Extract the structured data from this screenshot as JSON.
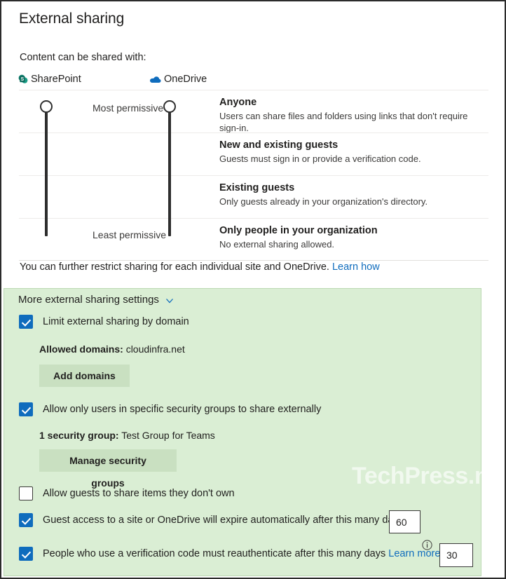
{
  "page": {
    "title": "External sharing",
    "intro_label": "Content can be shared with:",
    "restrict_note": "You can further restrict sharing for each individual site and OneDrive.",
    "restrict_link": "Learn how",
    "watermark": "TechPress.net"
  },
  "services": [
    {
      "name": "SharePoint",
      "icon": "sharepoint-icon",
      "color": "#0f7c6c"
    },
    {
      "name": "OneDrive",
      "icon": "onedrive-cloud-icon",
      "color": "#0f6cbd"
    }
  ],
  "permission_scale": {
    "most_label": "Most permissive",
    "least_label": "Least permissive",
    "sharepoint_value": "Anyone",
    "onedrive_value": "Anyone"
  },
  "options": [
    {
      "title": "Anyone",
      "description": "Users can share files and folders using links that don't require sign-in."
    },
    {
      "title": "New and existing guests",
      "description": "Guests must sign in or provide a verification code."
    },
    {
      "title": "Existing guests",
      "description": "Only guests already in your organization's directory."
    },
    {
      "title": "Only people in your organization",
      "description": "No external sharing allowed."
    }
  ],
  "more_settings": {
    "header": "More external sharing settings",
    "chevron": "chevron-down-icon",
    "limit_domain": {
      "label": "Limit external sharing by domain",
      "checked": true,
      "detail_label": "Allowed domains:",
      "detail_value": "cloudinfra.net",
      "button": "Add domains"
    },
    "security_groups": {
      "label": "Allow only users in specific security groups to share externally",
      "checked": true,
      "detail_label": "1 security group:",
      "detail_value": "Test Group for Teams",
      "button": "Manage security groups"
    },
    "guests_share_unowned": {
      "label": "Allow guests to share items they don't own",
      "checked": false
    },
    "guest_expiration": {
      "label": "Guest access to a site or OneDrive will expire automatically after this many days",
      "checked": true,
      "value": "60"
    },
    "verification_reauth": {
      "label": "People who use a verification code must reauthenticate after this many days",
      "link": "Learn more",
      "info_icon": "info-icon",
      "checked": true,
      "value": "30"
    }
  },
  "colors": {
    "panel_bg": "#daeed4",
    "accent_blue": "#0f6cbd",
    "button_bg": "#c9e0c1"
  }
}
